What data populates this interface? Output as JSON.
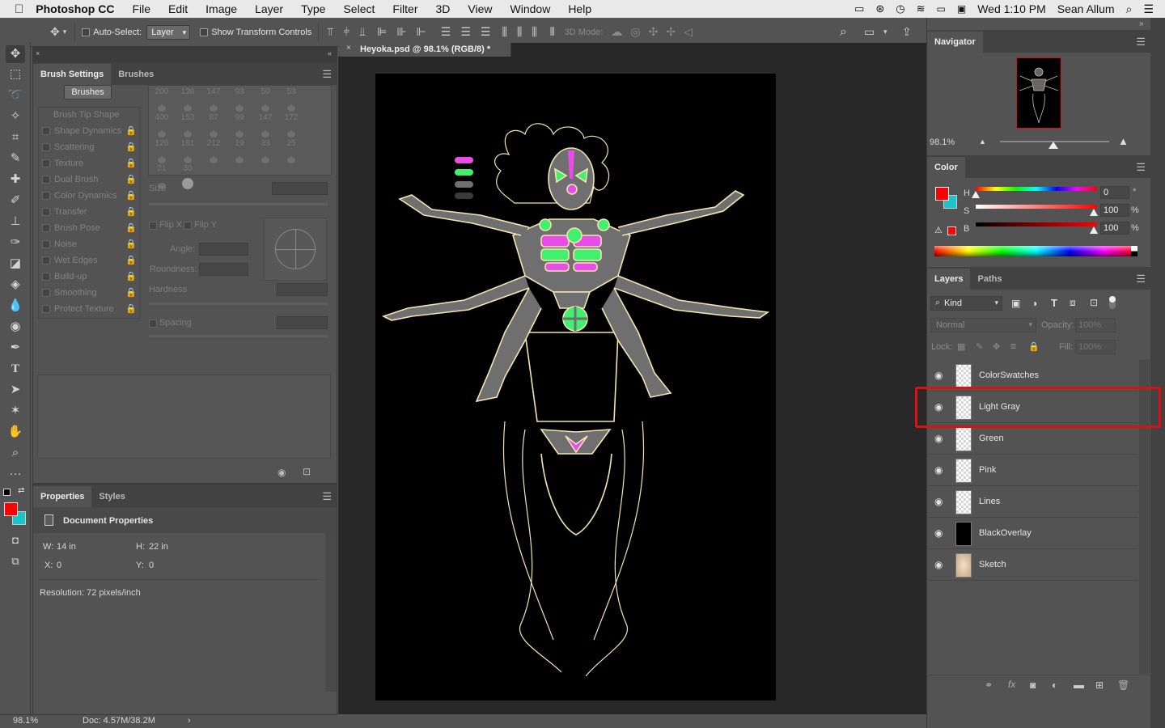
{
  "menubar": {
    "apple": "",
    "app": "Photoshop CC",
    "items": [
      "File",
      "Edit",
      "Image",
      "Layer",
      "Type",
      "Select",
      "Filter",
      "3D",
      "View",
      "Window",
      "Help"
    ],
    "clock": "Wed 1:10 PM",
    "user": "Sean Allum"
  },
  "options": {
    "auto_select_label": "Auto-Select:",
    "auto_select_value": "Layer",
    "show_transform_label": "Show Transform Controls",
    "mode_3d_label": "3D Mode:"
  },
  "brush_settings": {
    "tab_active": "Brush Settings",
    "tab_other": "Brushes",
    "brushes_button": "Brushes",
    "items": [
      "Brush Tip Shape",
      "Shape Dynamics",
      "Scattering",
      "Texture",
      "Dual Brush",
      "Color Dynamics",
      "Transfer",
      "Brush Pose",
      "Noise",
      "Wet Edges",
      "Build-up",
      "Smoothing",
      "Protect Texture"
    ],
    "tip_sizes_row1": [
      "200",
      "136",
      "147",
      "93",
      "50",
      "53"
    ],
    "tip_sizes_row2": [
      "400",
      "153",
      "87",
      "99",
      "147",
      "172"
    ],
    "tip_sizes_row3": [
      "126",
      "181",
      "212",
      "19",
      "33",
      "25"
    ],
    "tip_sizes_row4": [
      "21",
      "30"
    ],
    "size_label": "Size",
    "flip_x": "Flip X",
    "flip_y": "Flip Y",
    "angle_label": "Angle:",
    "roundness_label": "Roundness:",
    "hardness_label": "Hardness",
    "spacing_label": "Spacing"
  },
  "properties": {
    "tab_active": "Properties",
    "tab_other": "Styles",
    "heading": "Document Properties",
    "w_label": "W:",
    "w_value": "14 in",
    "h_label": "H:",
    "h_value": "22 in",
    "x_label": "X:",
    "x_value": "0",
    "y_label": "Y:",
    "y_value": "0",
    "resolution": "Resolution: 72 pixels/inch"
  },
  "document": {
    "tab_title": "Heyoka.psd @ 98.1% (RGB/8) *",
    "zoom": "98.1%",
    "doc_info": "Doc: 4.57M/38.2M"
  },
  "navigator": {
    "title": "Navigator",
    "zoom": "98.1%"
  },
  "color": {
    "title": "Color",
    "h_label": "H",
    "h_value": "0",
    "h_unit": "°",
    "s_label": "S",
    "s_value": "100",
    "s_unit": "%",
    "b_label": "B",
    "b_value": "100",
    "b_unit": "%",
    "foreground": "#ff0000",
    "background": "#1cc3c8"
  },
  "layers": {
    "tab_active": "Layers",
    "tab_other": "Paths",
    "kind_label": "Kind",
    "blend_mode": "Normal",
    "opacity_label": "Opacity:",
    "opacity_value": "100%",
    "lock_label": "Lock:",
    "fill_label": "Fill:",
    "fill_value": "100%",
    "items": [
      {
        "name": "ColorSwatches",
        "thumb": "transparent"
      },
      {
        "name": "Light Gray",
        "thumb": "transparent",
        "highlighted": true
      },
      {
        "name": "Green",
        "thumb": "transparent"
      },
      {
        "name": "Pink",
        "thumb": "transparent"
      },
      {
        "name": "Lines",
        "thumb": "transparent"
      },
      {
        "name": "BlackOverlay",
        "thumb": "black"
      },
      {
        "name": "Sketch",
        "thumb": "sketch"
      }
    ],
    "highlight_color": "#e01010"
  },
  "accent_colors": {
    "magenta": "#e84de8",
    "green": "#41f06c",
    "gray": "#6f6f6f",
    "line": "#f3e6b0"
  }
}
